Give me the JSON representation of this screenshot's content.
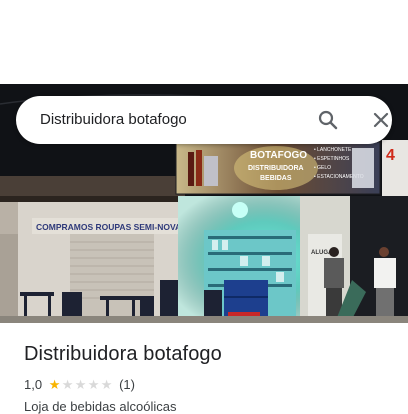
{
  "search": {
    "query": "Distribuidora botafogo"
  },
  "place": {
    "title": "Distribuidora botafogo",
    "rating": "1,0",
    "stars_filled": 1,
    "stars_total": 5,
    "review_count": "(1)",
    "category": "Loja de bebidas alcoólicas"
  },
  "photo": {
    "sign_main": "BOTAFOGO",
    "sign_sub": "DISTRIBUIDORA",
    "sign_sub2": "BEBIDAS",
    "sign_list": [
      "• LANCHONETE",
      "• ESPETINHOS",
      "• GELO",
      "• ESTACIONAMENTO"
    ],
    "wall_text": "COMPRAMOS ROUPAS  SEMI-NOVAS",
    "corner_number": "4",
    "side_sign": "ALUGA"
  },
  "colors": {
    "star": "#f8b400",
    "teal_light": "#2ee6c8"
  },
  "icons": [
    "search-icon",
    "close-icon",
    "star-icon"
  ]
}
